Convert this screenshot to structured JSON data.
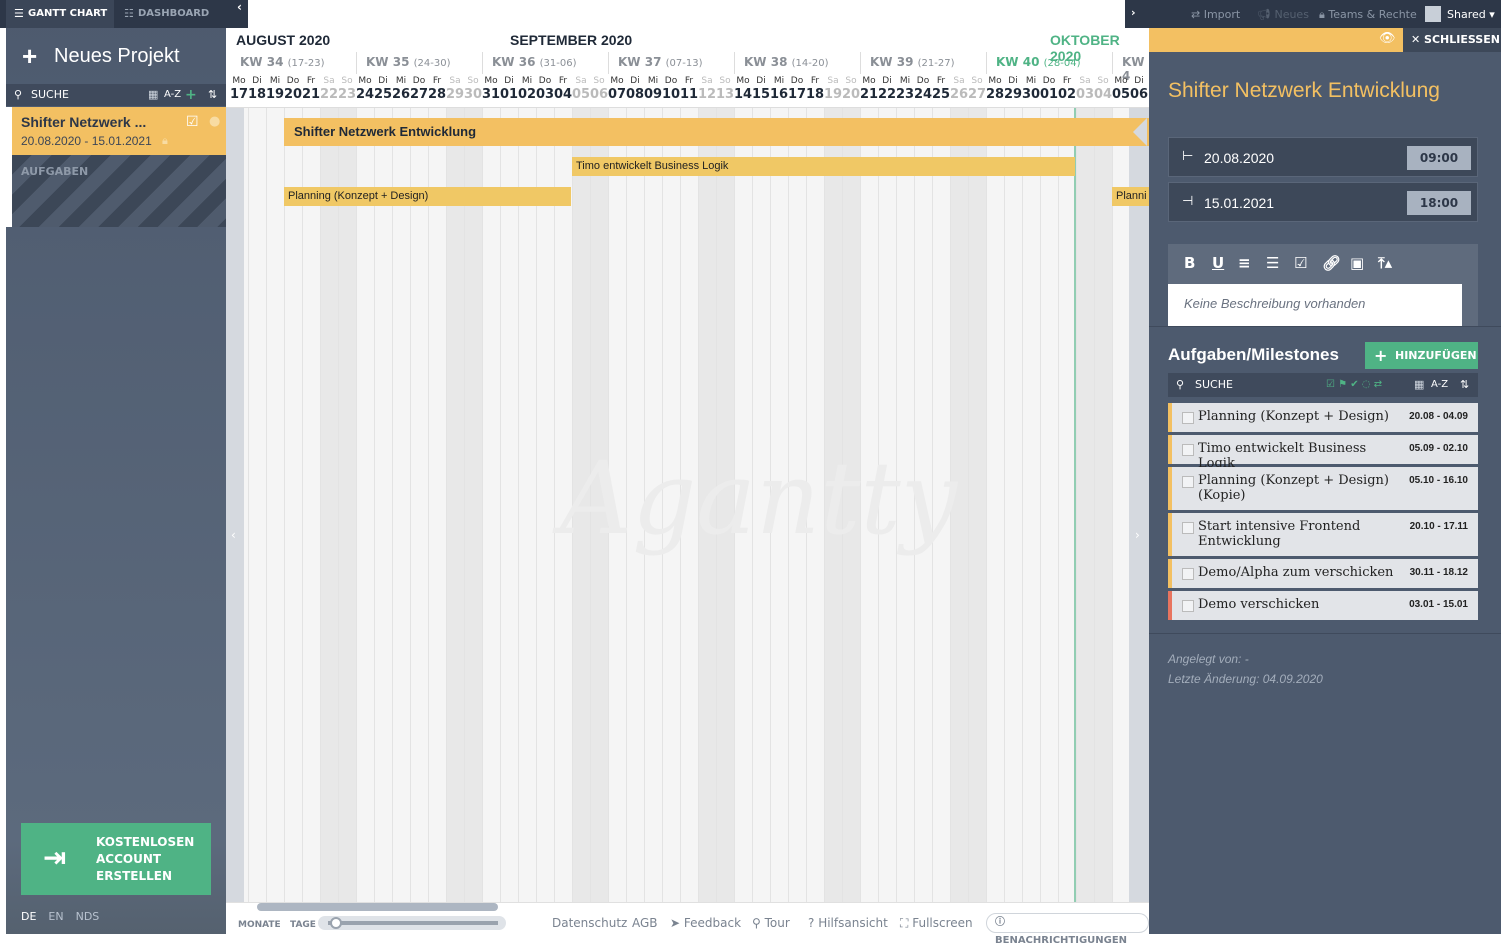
{
  "tabs": {
    "gantt": "GANTT CHART",
    "dashboard": "DASHBOARD"
  },
  "sidebar": {
    "new_project": "Neues Projekt",
    "search_label": "SUCHE",
    "sort_label": "A-Z",
    "project": {
      "title": "Shifter Netzwerk ...",
      "dates": "20.08.2020 - 15.01.2021"
    },
    "tasks_label": "AUFGABEN",
    "cta": "KOSTENLOSEN ACCOUNT ERSTELLEN",
    "languages": [
      "DE",
      "EN",
      "NDS"
    ]
  },
  "timeline": {
    "months": [
      "AUGUST 2020",
      "SEPTEMBER 2020",
      "OKTOBER 2020"
    ],
    "weeks": [
      {
        "kw": "KW 34",
        "range": "(17-23)"
      },
      {
        "kw": "KW 35",
        "range": "(24-30)"
      },
      {
        "kw": "KW 36",
        "range": "(31-06)"
      },
      {
        "kw": "KW 37",
        "range": "(07-13)"
      },
      {
        "kw": "KW 38",
        "range": "(14-20)"
      },
      {
        "kw": "KW 39",
        "range": "(21-27)"
      },
      {
        "kw": "KW 40",
        "range": "(28-04)"
      },
      {
        "kw": "KW 4",
        "range": ""
      }
    ],
    "day_names": [
      "Mo",
      "Di",
      "Mi",
      "Do",
      "Fr",
      "Sa",
      "So"
    ],
    "days": [
      "17",
      "18",
      "19",
      "20",
      "21",
      "22",
      "23",
      "24",
      "25",
      "26",
      "27",
      "28",
      "29",
      "30",
      "31",
      "01",
      "02",
      "03",
      "04",
      "05",
      "06",
      "07",
      "08",
      "09",
      "10",
      "11",
      "12",
      "13",
      "14",
      "15",
      "16",
      "17",
      "18",
      "19",
      "20",
      "21",
      "22",
      "23",
      "24",
      "25",
      "26",
      "27",
      "28",
      "29",
      "30",
      "01",
      "02",
      "03",
      "04",
      "05",
      "06"
    ],
    "bars": [
      {
        "label": "Shifter Netzwerk Entwicklung",
        "color": "#f3c062"
      },
      {
        "label": "Timo entwickelt Business Logik",
        "color": "#f0c865"
      },
      {
        "label": "Planning (Konzept + Design)",
        "color": "#f0c865"
      },
      {
        "label": "Planni",
        "color": "#f0c865"
      }
    ],
    "watermark": "Agantty"
  },
  "bottombar": {
    "monate": "MONATE",
    "tage": "TAGE",
    "links": [
      "Datenschutz",
      "AGB",
      "Feedback",
      "Tour",
      "Hilfsansicht",
      "Fullscreen"
    ],
    "notifications": "BENACHRICHTIGUNGEN"
  },
  "topbar": {
    "import": "Import",
    "neues": "Neues",
    "teams": "Teams & Rechte",
    "shared": "Shared"
  },
  "panel": {
    "close": "SCHLIESSEN",
    "title": "Shifter Netzwerk Entwicklung",
    "start_date": "20.08.2020",
    "start_time": "09:00",
    "end_date": "15.01.2021",
    "end_time": "18:00",
    "description_placeholder": "Keine Beschreibung vorhanden",
    "tasks_heading": "Aufgaben/Milestones",
    "add_label": "HINZUFÜGEN",
    "search_label": "SUCHE",
    "sort_label": "A-Z",
    "tasks": [
      {
        "name": "Planning (Konzept + Design)",
        "range": "20.08 - 04.09",
        "color": "#f3c062"
      },
      {
        "name": "Timo entwickelt Business Logik",
        "range": "05.09 - 02.10",
        "color": "#f3c062"
      },
      {
        "name": "Planning (Konzept + Design) (Kopie)",
        "range": "05.10 - 16.10",
        "color": "#f3c062"
      },
      {
        "name": "Start intensive Frontend Entwicklung",
        "range": "20.10 - 17.11",
        "color": "#f3c062"
      },
      {
        "name": "Demo/Alpha zum verschicken",
        "range": "30.11 - 18.12",
        "color": "#f3c062"
      },
      {
        "name": "Demo verschicken",
        "range": "03.01 - 15.01",
        "color": "#e8745f"
      }
    ],
    "created_by": "Angelegt von: -",
    "last_change": "Letzte Änderung: 04.09.2020"
  }
}
